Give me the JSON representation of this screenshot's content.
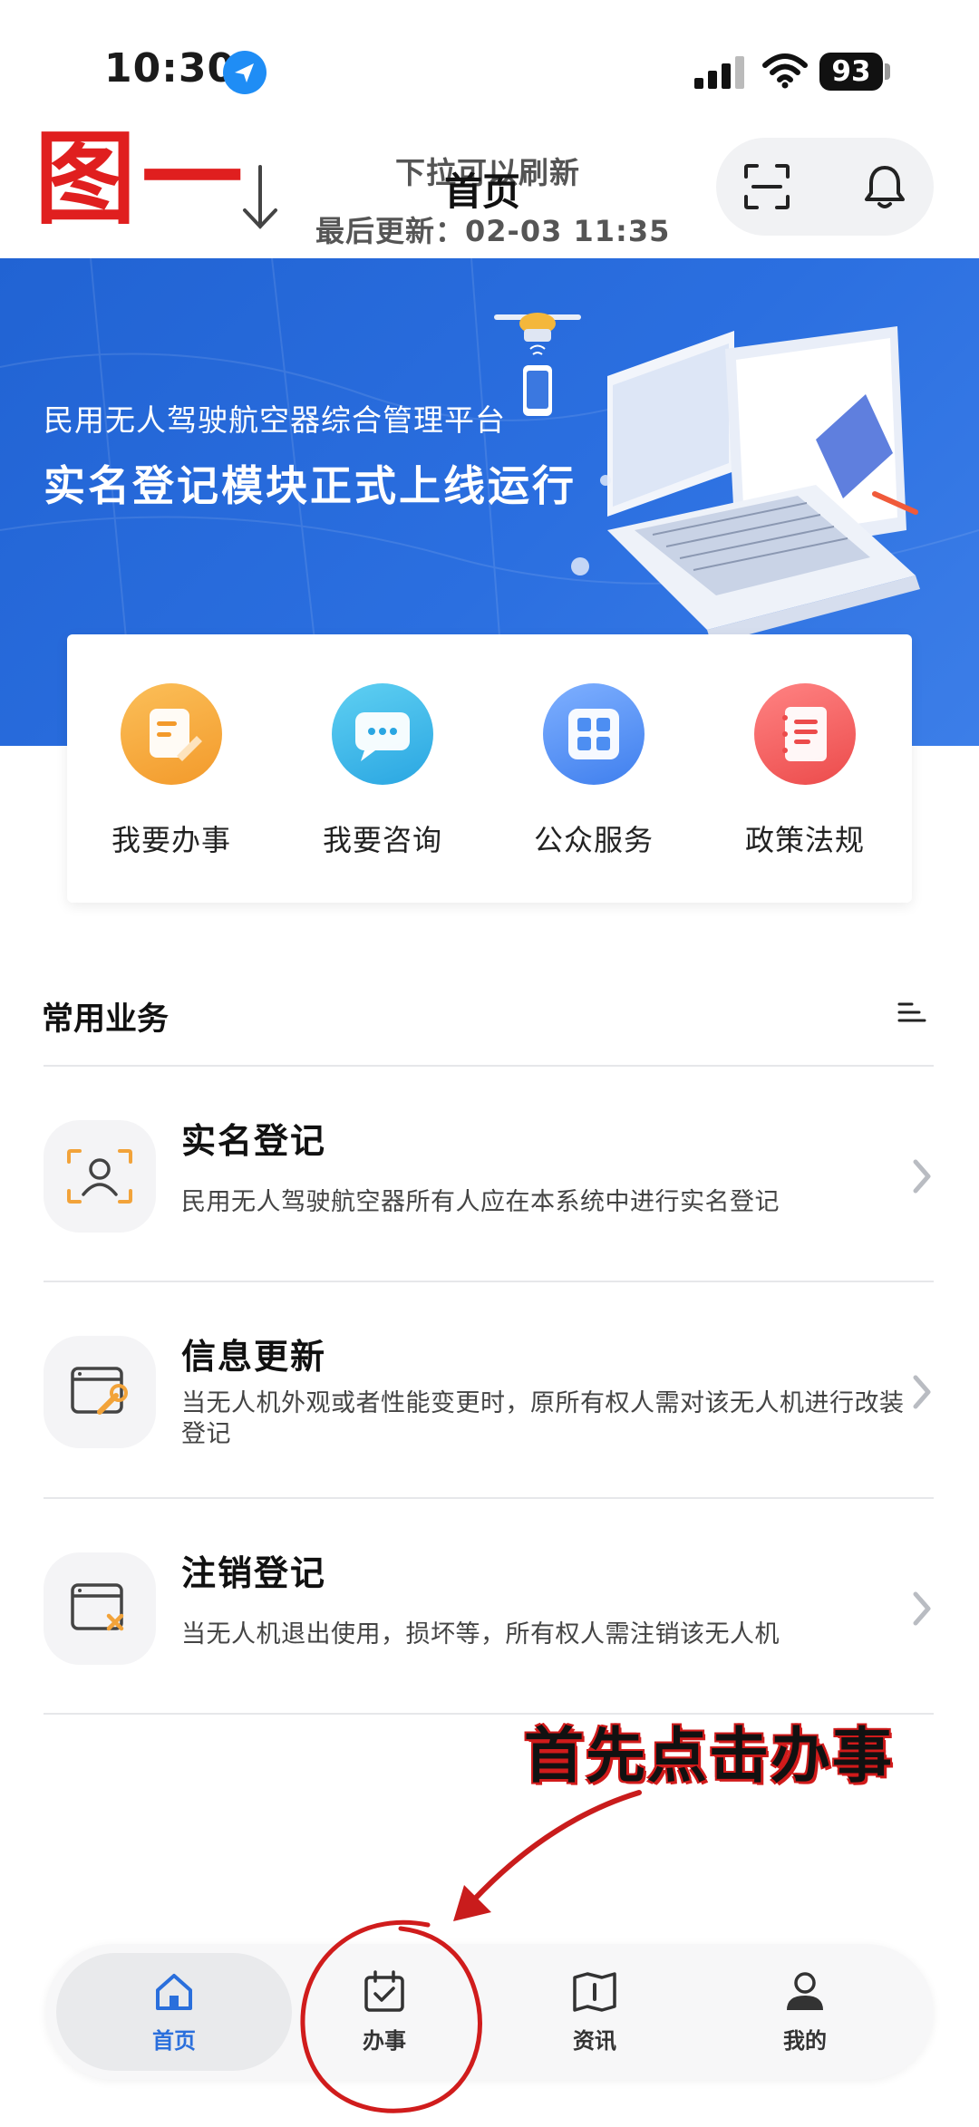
{
  "status_bar": {
    "time": "10:30",
    "battery": "93"
  },
  "header": {
    "annotation_figure": "图一",
    "pull_hint": "下拉可以刷新",
    "title": "首页",
    "last_update": "最后更新：02-03 11:35",
    "scan_icon": "scan-icon",
    "bell_icon": "bell-icon"
  },
  "banner": {
    "subtitle": "民用无人驾驶航空器综合管理平台",
    "title": "实名登记模块正式上线运行"
  },
  "quick_actions": [
    {
      "label": "我要办事",
      "icon": "document-edit-icon",
      "color": "#f7a43c"
    },
    {
      "label": "我要咨询",
      "icon": "chat-bubble-icon",
      "color": "#3bb6e8"
    },
    {
      "label": "公众服务",
      "icon": "grid-apps-icon",
      "color": "#4d8ef2"
    },
    {
      "label": "政策法规",
      "icon": "notebook-icon",
      "color": "#f05a5a"
    }
  ],
  "section": {
    "title": "常用业务",
    "menu_icon": "list-menu-icon"
  },
  "business": [
    {
      "title": "实名登记",
      "desc": "民用无人驾驶航空器所有人应在本系统中进行实名登记",
      "icon": "face-scan-icon"
    },
    {
      "title": "信息更新",
      "desc": "当无人机外观或者性能变更时，原所有权人需对该无人机进行改装登记",
      "icon": "window-wrench-icon"
    },
    {
      "title": "注销登记",
      "desc": "当无人机退出使用，损坏等，所有权人需注销该无人机",
      "icon": "window-cancel-icon"
    }
  ],
  "callout": "首先点击办事",
  "tabbar": [
    {
      "label": "首页",
      "icon": "home-icon",
      "active": true
    },
    {
      "label": "办事",
      "icon": "calendar-check-icon",
      "active": false
    },
    {
      "label": "资讯",
      "icon": "book-info-icon",
      "active": false
    },
    {
      "label": "我的",
      "icon": "user-icon",
      "active": false
    }
  ],
  "colors": {
    "accent": "#2a6fdc",
    "banner": "#2668d9",
    "annotation": "#e01f1f"
  }
}
